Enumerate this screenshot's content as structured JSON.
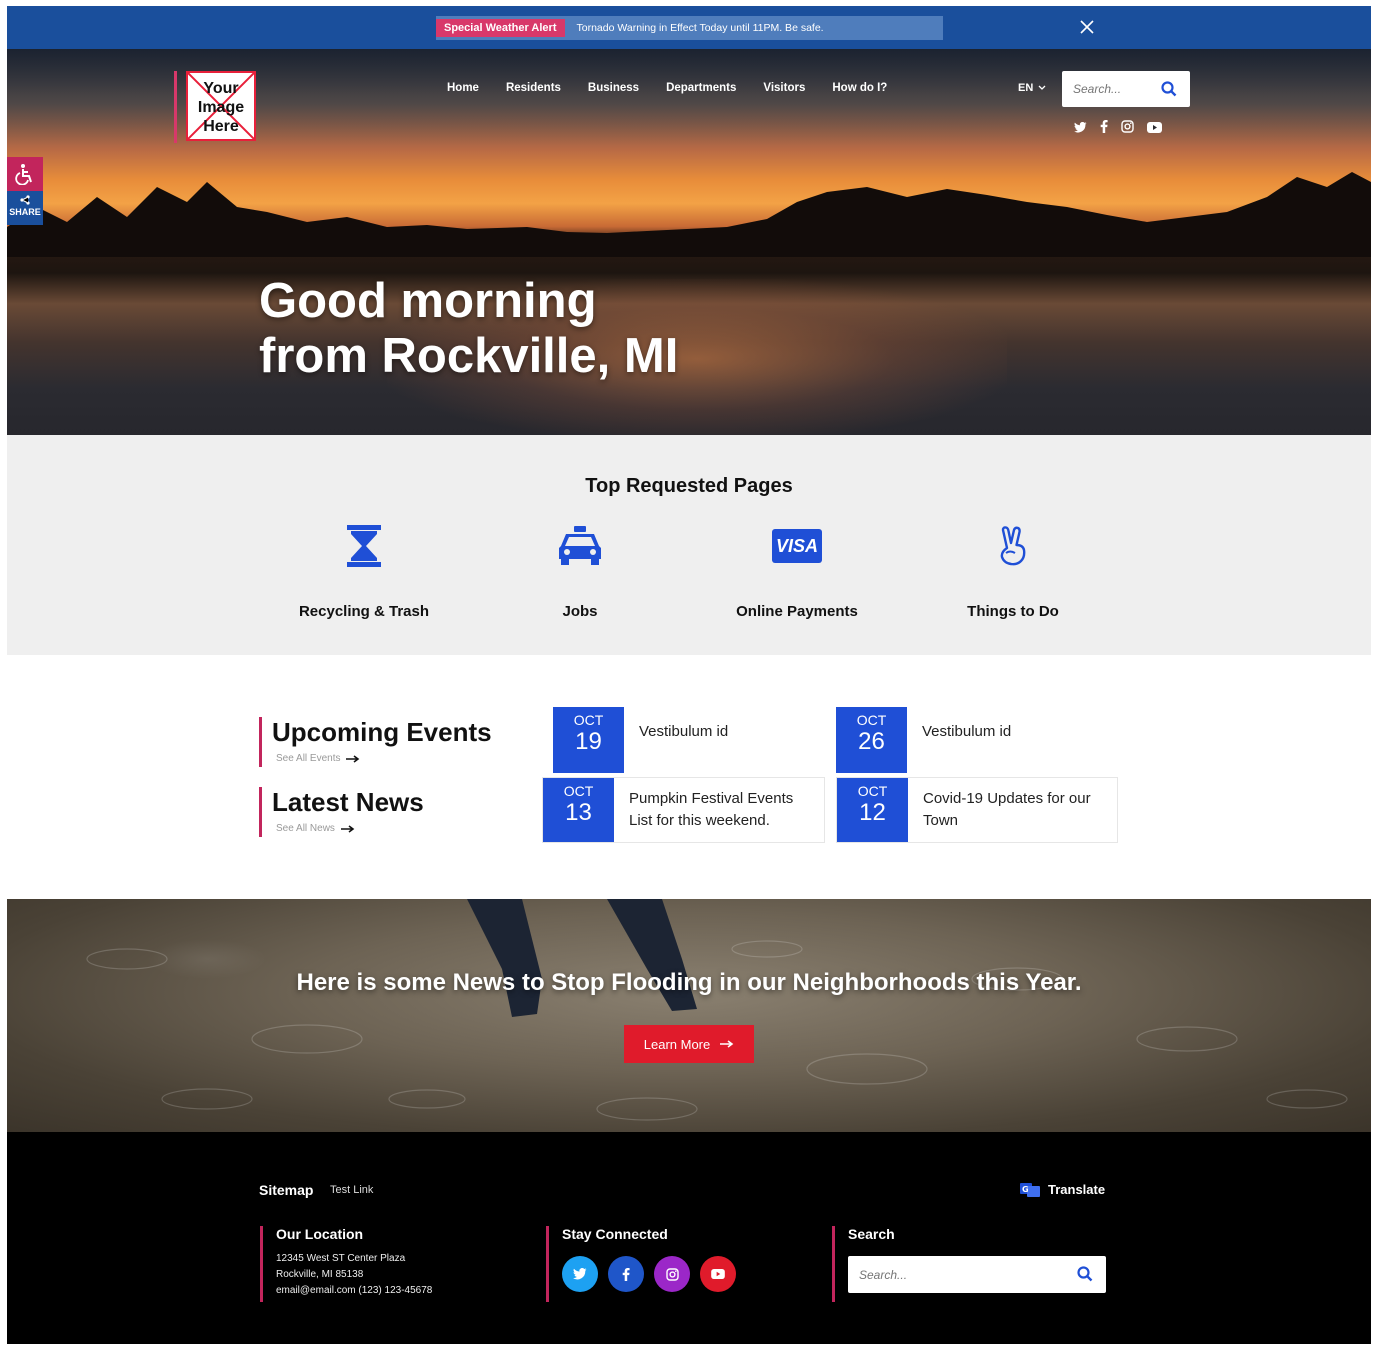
{
  "alert": {
    "tag": "Special Weather Alert",
    "text": "Tornado Warning in Effect Today until 11PM.  Be safe."
  },
  "logo": {
    "text": "Your Image Here"
  },
  "nav": {
    "items": [
      "Home",
      "Residents",
      "Business",
      "Departments",
      "Visitors",
      "How do I?"
    ],
    "language": "EN"
  },
  "search": {
    "placeholder": "Search..."
  },
  "side_tools": {
    "share_label": "SHARE"
  },
  "hero": {
    "line1": "Good morning",
    "line2": "from Rockville, MI"
  },
  "top_requested": {
    "title": "Top Requested Pages",
    "items": [
      {
        "label": "Recycling & Trash",
        "icon": "hourglass-icon"
      },
      {
        "label": "Jobs",
        "icon": "car-icon"
      },
      {
        "label": "Online Payments",
        "icon": "visa-icon"
      },
      {
        "label": "Things to Do",
        "icon": "peace-hand-icon"
      }
    ],
    "visa_text": "VISA"
  },
  "events": {
    "title": "Upcoming Events",
    "see_all": "See All Events",
    "items": [
      {
        "month": "OCT",
        "day": "19",
        "title": "Vestibulum id"
      },
      {
        "month": "OCT",
        "day": "26",
        "title": "Vestibulum id"
      }
    ]
  },
  "news": {
    "title": "Latest News",
    "see_all": "See All News",
    "items": [
      {
        "month": "OCT",
        "day": "13",
        "title_line1": "Pumpkin Festival Events",
        "title_line2": "List for this weekend."
      },
      {
        "month": "OCT",
        "day": "12",
        "title_line1": "Covid-19 Updates for our",
        "title_line2": "Town"
      }
    ]
  },
  "flood": {
    "title": "Here is  some News to Stop Flooding in our Neighborhoods this Year.",
    "button": "Learn More"
  },
  "footer": {
    "sitemap": "Sitemap",
    "test_link": "Test Link",
    "translate": "Translate",
    "location_title": "Our Location",
    "address_line1": "12345 West ST Center Plaza",
    "address_line2": "Rockville, MI 85138",
    "address_line3": "email@email.com (123) 123-45678",
    "connected_title": "Stay Connected",
    "search_title": "Search",
    "search_placeholder": "Search..."
  },
  "colors": {
    "primary_blue": "#1f4fd6",
    "alert_blue": "#1a4f9c",
    "accent_pink": "#c2255c",
    "button_red": "#e01b2b",
    "twitter": "#1da1f2",
    "facebook": "#1877f2",
    "instagram": "#9b27c8",
    "youtube": "#e01b2b"
  }
}
